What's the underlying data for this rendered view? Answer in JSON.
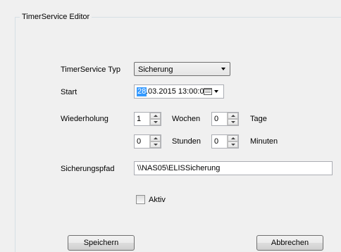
{
  "group": {
    "title": "TimerService Editor"
  },
  "form": {
    "type_label": "TimerService Typ",
    "type_value": "Sicherung",
    "start_label": "Start",
    "start_day": "28",
    "start_rest": ".03.2015 13:00:00",
    "repeat_label": "Wiederholung",
    "weeks_value": "1",
    "weeks_label": "Wochen",
    "days_value": "0",
    "days_label": "Tage",
    "hours_value": "0",
    "hours_label": "Stunden",
    "minutes_value": "0",
    "minutes_label": "Minuten",
    "path_label": "Sicherungspfad",
    "path_value": "\\\\NAS05\\ELISSicherung",
    "active_label": "Aktiv"
  },
  "buttons": {
    "save": "Speichern",
    "cancel": "Abbrechen"
  },
  "icons": {
    "calendar": "calendar-icon",
    "dropdown": "chevron-down-icon",
    "spin_up": "spin-up-icon",
    "spin_down": "spin-down-icon"
  }
}
